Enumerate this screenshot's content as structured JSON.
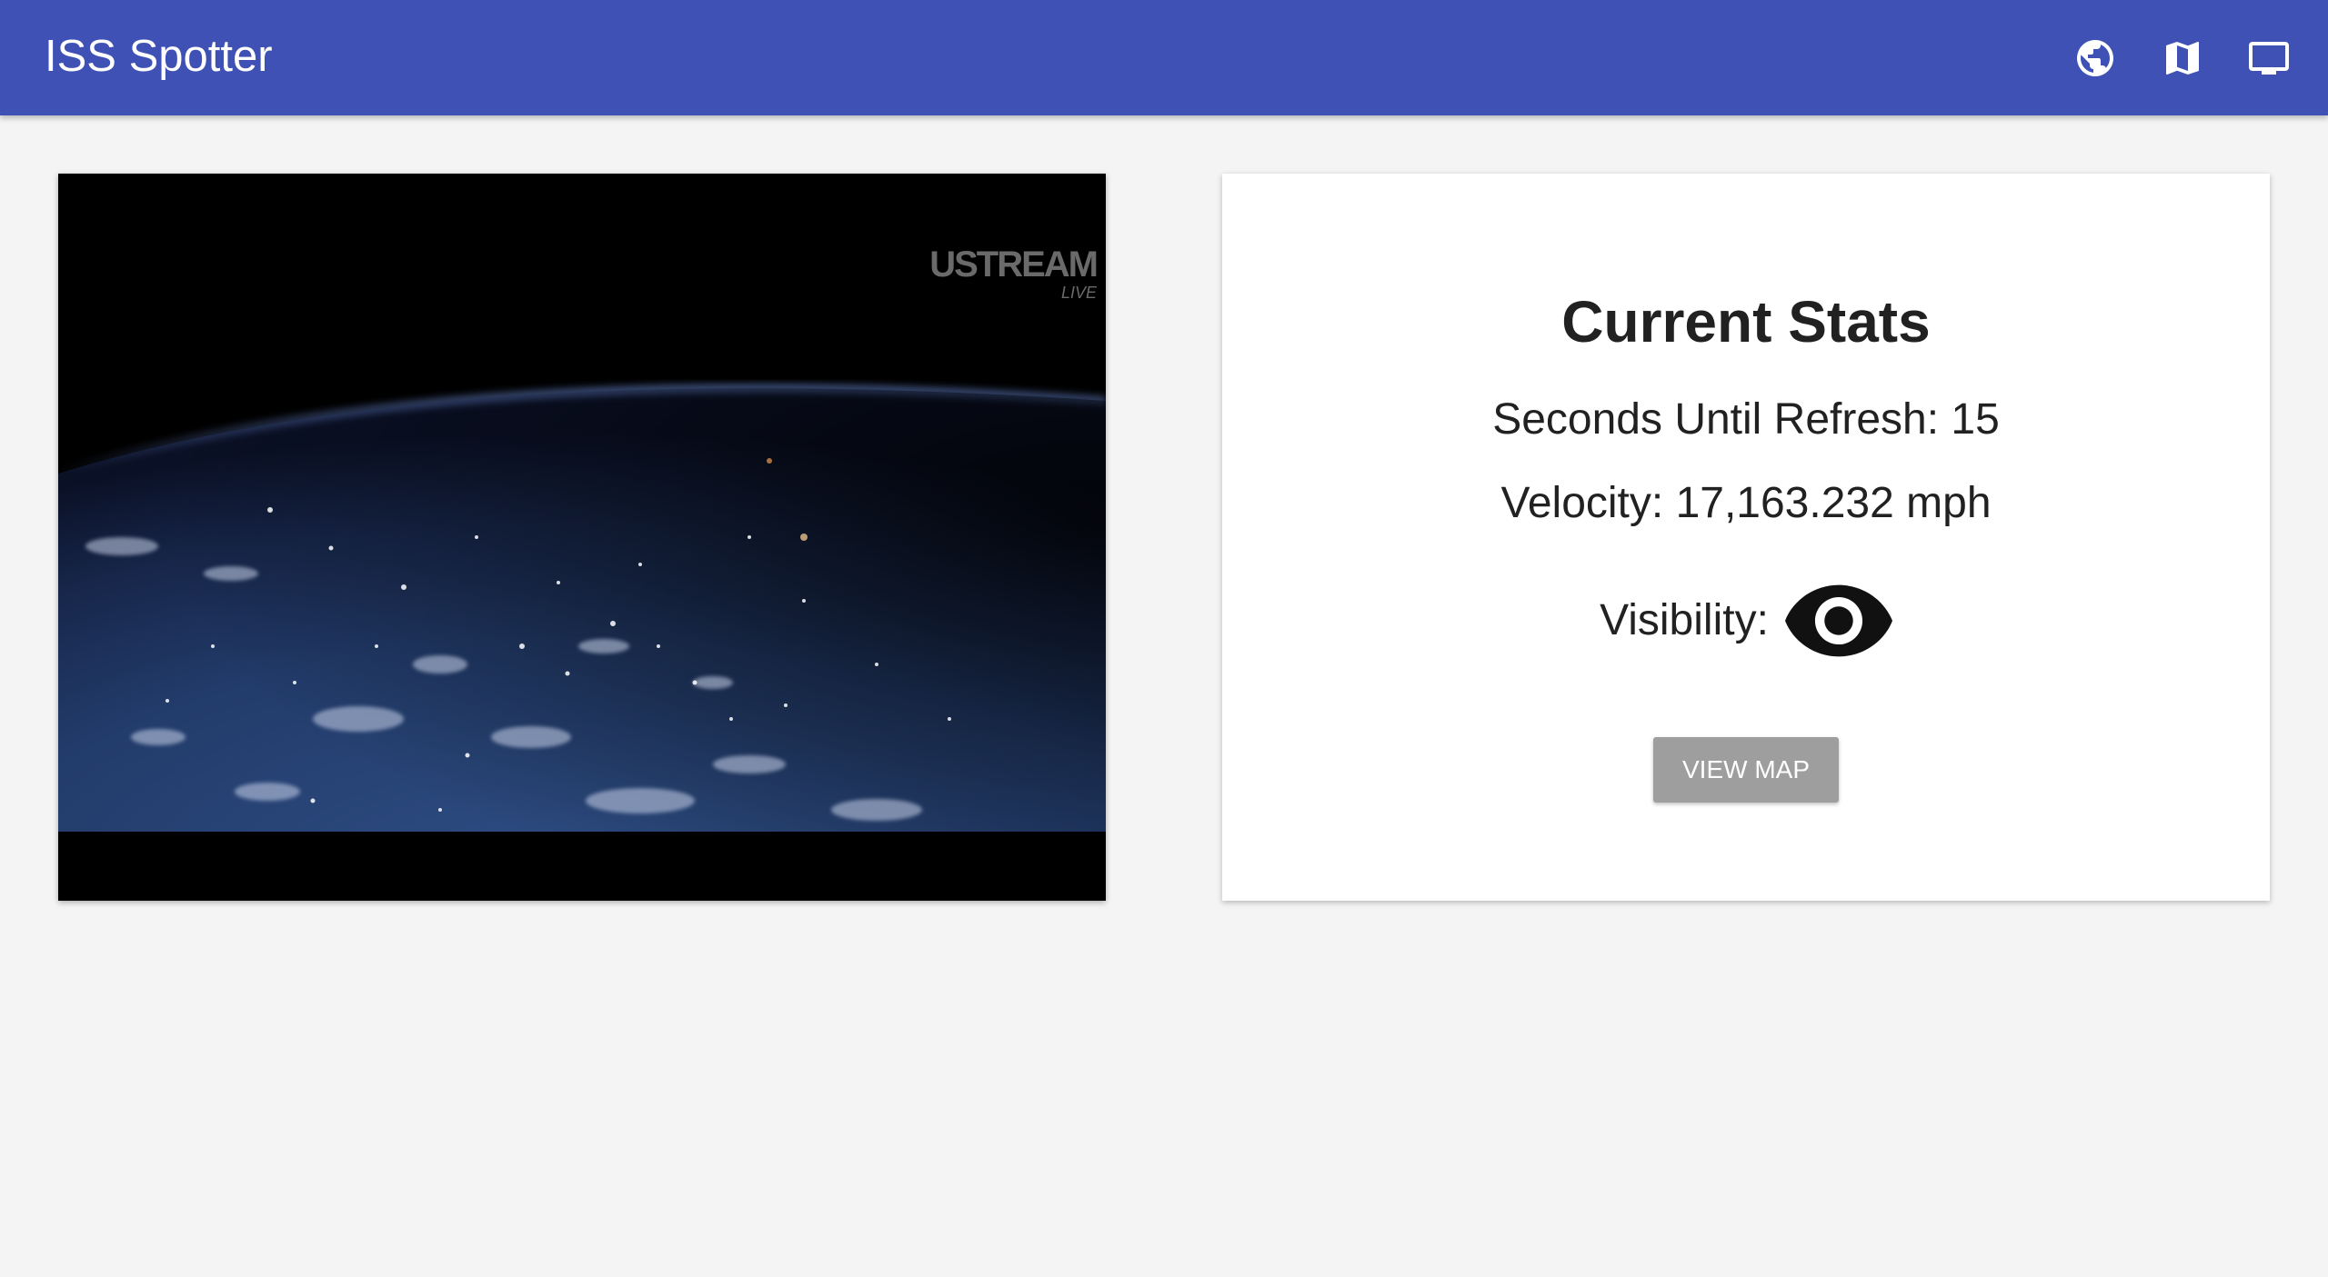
{
  "app": {
    "title": "ISS Spotter",
    "accent_color": "#3f51b5",
    "toolbar_icons": [
      "globe-icon",
      "map-icon",
      "tv-icon"
    ]
  },
  "video": {
    "watermark_main": "USTREAM",
    "watermark_sub": "LIVE"
  },
  "stats": {
    "title": "Current Stats",
    "refresh_label": "Seconds Until Refresh: 15",
    "velocity_label": "Velocity: 17,163.232 mph",
    "visibility_label": "Visibility:",
    "visibility_icon": "eye-icon",
    "view_map_label": "VIEW MAP",
    "button_color": "#9e9e9e"
  }
}
